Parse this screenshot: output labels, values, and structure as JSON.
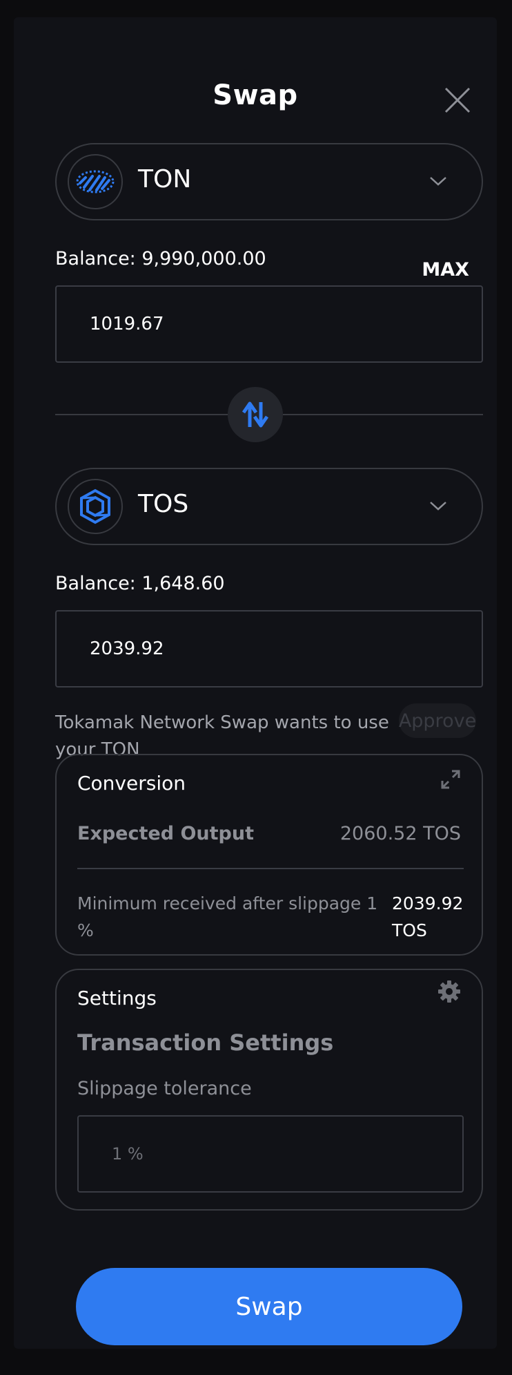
{
  "header": {
    "title": "Swap"
  },
  "from": {
    "token": "TON",
    "balance": "Balance: 9,990,000.00",
    "max_label": "MAX",
    "amount": "1019.67"
  },
  "to": {
    "token": "TOS",
    "balance": "Balance: 1,648.60",
    "amount": "2039.92"
  },
  "approve": {
    "message": "Tokamak Network Swap wants to use your TON",
    "button_label": "Approve"
  },
  "conversion": {
    "title": "Conversion",
    "expected_output_label": "Expected Output",
    "expected_output_value": "2060.52 TOS",
    "min_received_label": "Minimum received after slippage 1 %",
    "min_received_value": "2039.92 TOS"
  },
  "settings": {
    "title": "Settings",
    "section_title": "Transaction Settings",
    "slippage_label": "Slippage tolerance",
    "slippage_value": "1 %"
  },
  "swap_button_label": "Swap",
  "colors": {
    "accent": "#2f7bf1",
    "background": "#111217",
    "border": "#383a40",
    "muted_text": "#8e9097"
  },
  "icons": {
    "close": "close-icon",
    "from_token": "ton-token-icon",
    "to_token": "tos-token-icon",
    "dropdown": "chevron-down-icon",
    "swap_direction": "swap-arrows-icon",
    "expand": "expand-icon",
    "settings": "gear-icon"
  }
}
